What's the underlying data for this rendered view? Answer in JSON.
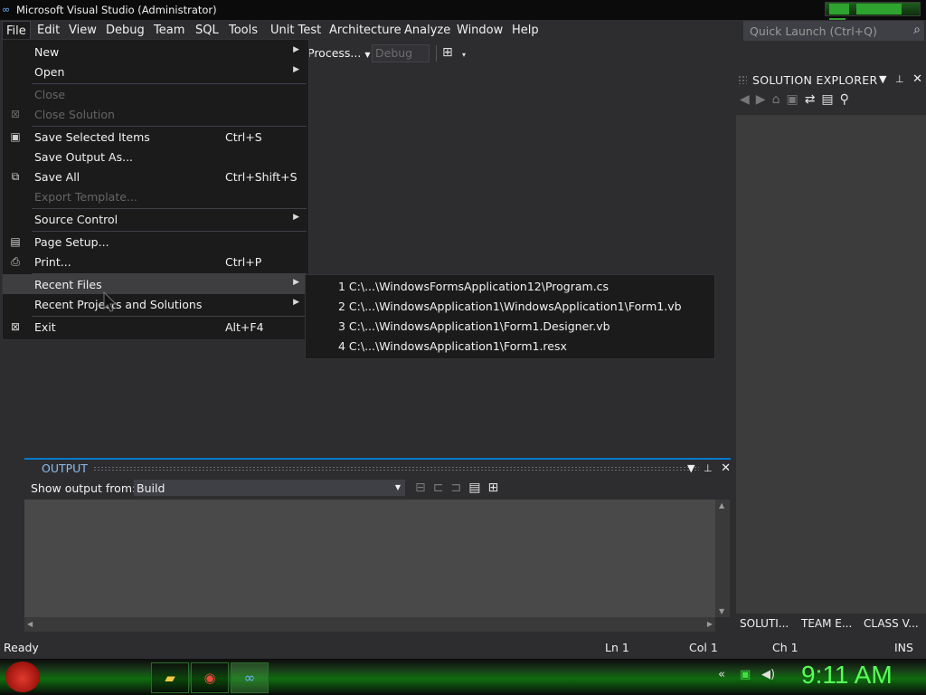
{
  "window": {
    "title": "Microsoft Visual Studio (Administrator)"
  },
  "menubar": {
    "items": [
      "File",
      "Edit",
      "View",
      "Debug",
      "Team",
      "SQL",
      "Tools",
      "Unit Test",
      "Architecture",
      "Analyze",
      "Window",
      "Help"
    ],
    "quick_launch_placeholder": "Quick Launch (Ctrl+Q)"
  },
  "toolbar": {
    "process_label": "Process...",
    "config_value": "Debug"
  },
  "file_menu": {
    "items": [
      {
        "label": "New",
        "shortcut": "",
        "submenu": true
      },
      {
        "label": "Open",
        "shortcut": "",
        "submenu": true
      },
      {
        "label": "Close",
        "shortcut": "",
        "disabled": true
      },
      {
        "label": "Close Solution",
        "shortcut": "",
        "disabled": true
      },
      {
        "label": "Save Selected Items",
        "shortcut": "Ctrl+S"
      },
      {
        "label": "Save Output As...",
        "shortcut": ""
      },
      {
        "label": "Save All",
        "shortcut": "Ctrl+Shift+S"
      },
      {
        "label": "Export Template...",
        "shortcut": "",
        "disabled": true
      },
      {
        "label": "Source Control",
        "shortcut": "",
        "submenu": true
      },
      {
        "label": "Page Setup...",
        "shortcut": ""
      },
      {
        "label": "Print...",
        "shortcut": "Ctrl+P"
      },
      {
        "label": "Recent Files",
        "shortcut": "",
        "submenu": true,
        "highlighted": true
      },
      {
        "label": "Recent Projects and Solutions",
        "shortcut": "",
        "submenu": true
      },
      {
        "label": "Exit",
        "shortcut": "Alt+F4"
      }
    ]
  },
  "recent_files": [
    "1 C:\\...\\WindowsFormsApplication12\\Program.cs",
    "2 C:\\...\\WindowsApplication1\\WindowsApplication1\\Form1.vb",
    "3 C:\\...\\WindowsApplication1\\Form1.Designer.vb",
    "4 C:\\...\\WindowsApplication1\\Form1.resx"
  ],
  "solution_explorer": {
    "title": "SOLUTION EXPLORER",
    "tabs": [
      "SOLUTI...",
      "TEAM E...",
      "CLASS V..."
    ]
  },
  "output": {
    "title": "OUTPUT",
    "show_label": "Show output from:",
    "source_value": "Build"
  },
  "statusbar": {
    "status": "Ready",
    "line": "Ln 1",
    "col": "Col 1",
    "ch": "Ch 1",
    "mode": "INS"
  },
  "taskbar": {
    "clock": "9:11 AM"
  },
  "colors": {
    "accent": "#007acc",
    "clock": "#57ff57",
    "menu_bg": "#1b1b1c",
    "ide_bg": "#2d2d30"
  }
}
